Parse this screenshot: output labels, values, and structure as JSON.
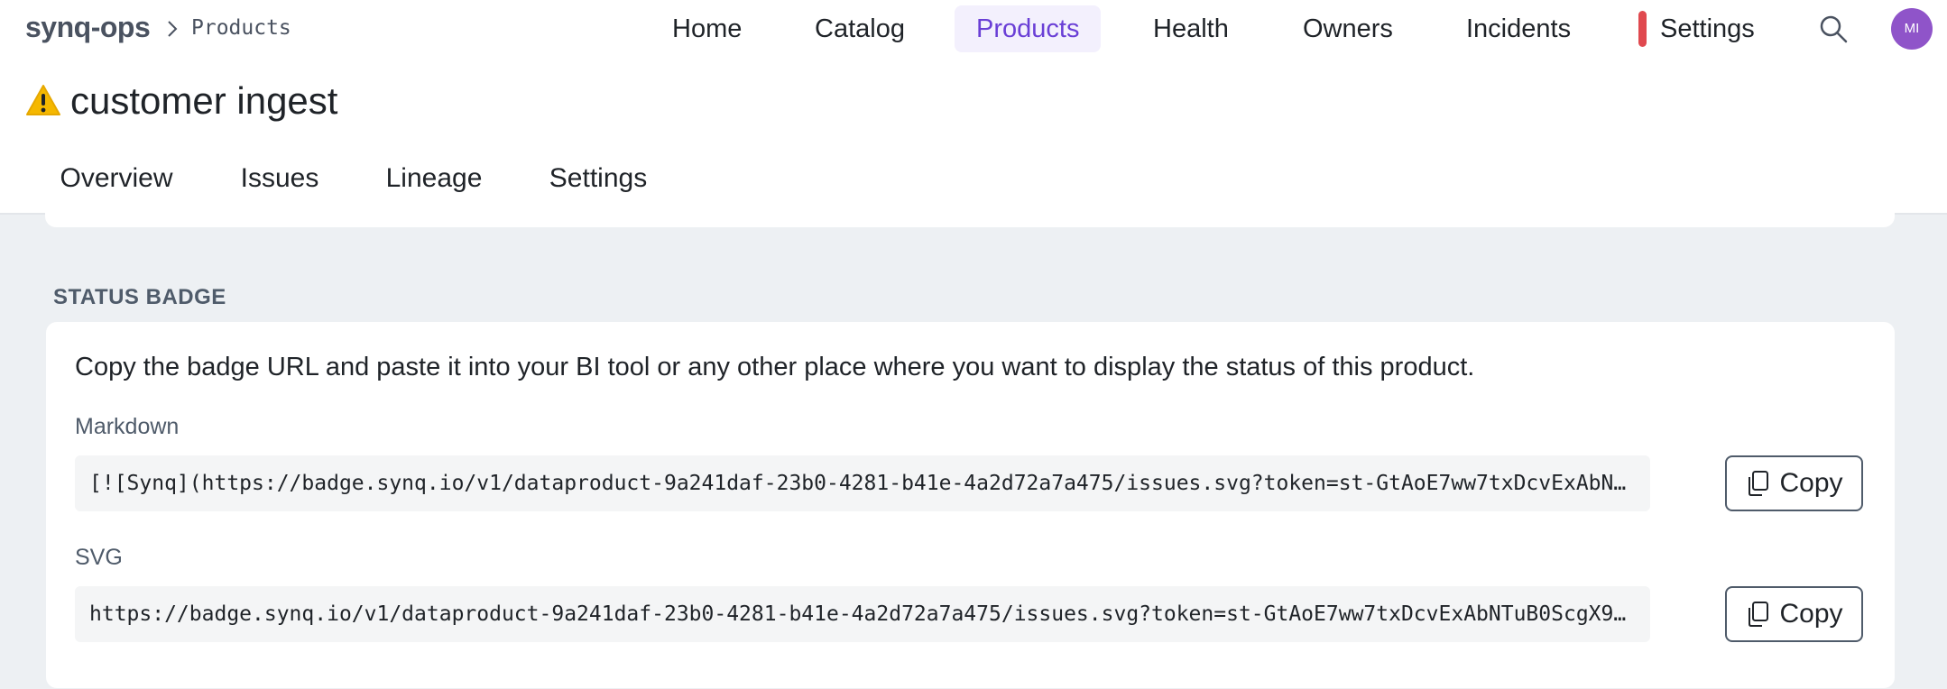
{
  "header": {
    "app_name": "synq-ops",
    "current_page": "Products",
    "nav": [
      {
        "label": "Home"
      },
      {
        "label": "Catalog"
      },
      {
        "label": "Products",
        "active": true
      },
      {
        "label": "Health"
      },
      {
        "label": "Owners"
      },
      {
        "label": "Incidents"
      },
      {
        "label": "Settings"
      }
    ],
    "avatar_initials": "MI",
    "settings_marker_color": "#e0494f"
  },
  "product": {
    "title": "customer ingest",
    "status_icon": "warning-icon"
  },
  "tabs": [
    {
      "label": "Overview"
    },
    {
      "label": "Issues"
    },
    {
      "label": "Lineage"
    },
    {
      "label": "Settings",
      "active": true
    }
  ],
  "status_badge": {
    "section_title": "STATUS BADGE",
    "description": "Copy the badge URL and paste it into your BI tool or any other place where you want to display the status of this product.",
    "markdown": {
      "label": "Markdown",
      "value": "[![Synq](https://badge.synq.io/v1/dataproduct-9a241daf-23b0-4281-b41e-4a2d72a7a475/issues.svg?token=st-GtAoE7ww7txDcvExAbN…",
      "copy_label": "Copy"
    },
    "svg": {
      "label": "SVG",
      "value": "https://badge.synq.io/v1/dataproduct-9a241daf-23b0-4281-b41e-4a2d72a7a475/issues.svg?token=st-GtAoE7ww7txDcvExAbNTuB0ScgX9…",
      "copy_label": "Copy"
    }
  },
  "colors": {
    "accent": "#6a3fd6",
    "accent_bg": "#f3f0fd",
    "avatar": "#8f54c9",
    "content_bg": "#edf0f3"
  }
}
